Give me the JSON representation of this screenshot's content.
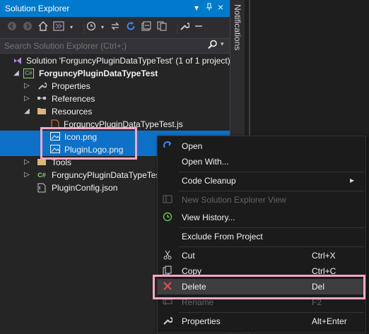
{
  "panel": {
    "title": "Solution Explorer",
    "pin_glyph": "▾",
    "pin2_glyph": "⊣",
    "close_glyph": "×"
  },
  "notifications": {
    "label": "Notifications"
  },
  "search": {
    "placeholder": "Search Solution Explorer (Ctrl+;)"
  },
  "toolbar": {
    "icons": [
      "back-icon",
      "forward-icon",
      "home-icon",
      "vs-icon",
      "dropdown-icon",
      "history-icon",
      "sync-icon",
      "refresh-icon",
      "collapse-icon",
      "show-all-files-icon",
      "properties-icon",
      "wrench-icon",
      "minus-icon"
    ]
  },
  "tree": {
    "solution": "Solution 'ForguncyPluginDataTypeTest' (1 of 1 project)",
    "project": "ForguncyPluginDataTypeTest",
    "properties": "Properties",
    "references": "References",
    "resources": "Resources",
    "resources_child": "ForguncyPluginDataTypeTest.js",
    "icon_file": "Icon.png",
    "logo_file": "PluginLogo.png",
    "tools": "Tools",
    "cs_file": "ForguncyPluginDataTypeTest",
    "config": "PluginConfig.json"
  },
  "menu": {
    "open": "Open",
    "open_with": "Open With...",
    "code_cleanup": "Code Cleanup",
    "new_view": "New Solution Explorer View",
    "view_history": "View History...",
    "exclude": "Exclude From Project",
    "cut": "Cut",
    "cut_sc": "Ctrl+X",
    "copy": "Copy",
    "copy_sc": "Ctrl+C",
    "delete": "Delete",
    "delete_sc": "Del",
    "rename": "Rename",
    "rename_sc": "F2",
    "properties": "Properties",
    "properties_sc": "Alt+Enter"
  },
  "colors": {
    "accent": "#007acc",
    "selection": "#0e71c8",
    "highlight_box": "#f4a7c4",
    "delete_icon": "#e05252"
  }
}
